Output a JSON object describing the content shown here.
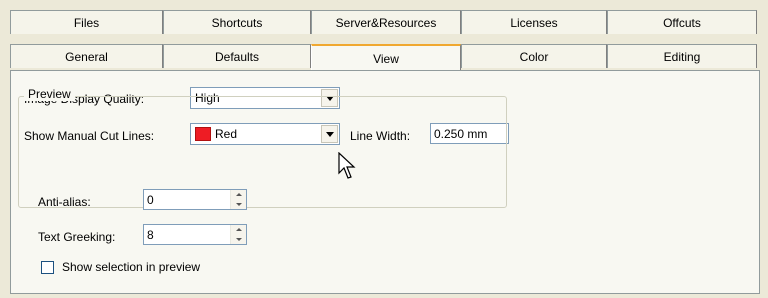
{
  "tabs_back": [
    "Files",
    "Shortcuts",
    "Server&Resources",
    "Licenses",
    "Offcuts"
  ],
  "tabs_front": [
    "General",
    "Defaults",
    "View",
    "Color",
    "Editing"
  ],
  "active_tab": "View",
  "view": {
    "image_quality_label": "Image Display Quality:",
    "image_quality_value": "High",
    "cut_lines_label": "Show Manual Cut Lines:",
    "cut_lines_value": "Red",
    "cut_lines_color": "#ee1c24",
    "line_width_label": "Line Width:",
    "line_width_value": "0.250 mm"
  },
  "preview": {
    "title": "Preview",
    "anti_alias_label": "Anti-alias:",
    "anti_alias_value": "0",
    "text_greeking_label": "Text Greeking:",
    "text_greeking_value": "8",
    "show_selection_label": "Show selection in preview",
    "show_selection_checked": false
  }
}
